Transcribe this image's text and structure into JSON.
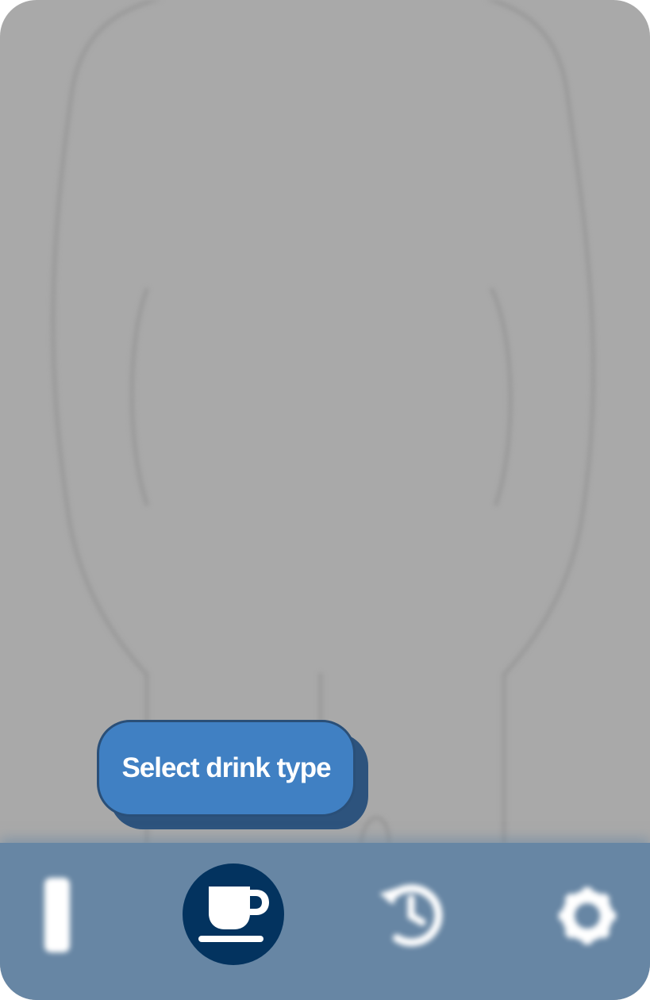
{
  "tooltip": {
    "text": "Select drink type"
  },
  "bottom_nav": {
    "items": [
      {
        "icon": "bottle-icon",
        "active": false
      },
      {
        "icon": "coffee-cup-icon",
        "active": true
      },
      {
        "icon": "history-icon",
        "active": false
      },
      {
        "icon": "gear-icon",
        "active": false
      }
    ]
  },
  "colors": {
    "background_overlay": "#a9a9a9",
    "nav_bar": "#6786a4",
    "active_nav": "#03335f",
    "tooltip_fill": "#4080c3",
    "tooltip_shadow": "#2d537d",
    "icon_light": "#ffffff"
  }
}
